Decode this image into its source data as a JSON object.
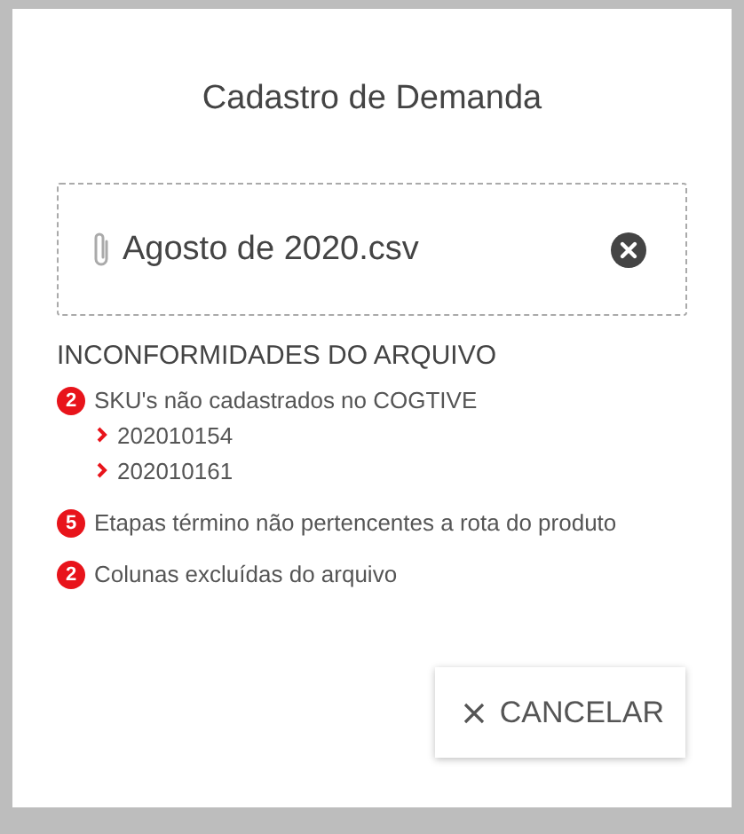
{
  "dialog": {
    "title": "Cadastro de Demanda"
  },
  "file": {
    "name": "Agosto de 2020.csv"
  },
  "section": {
    "title": "INCONFORMIDADES DO ARQUIVO"
  },
  "issues": [
    {
      "count": "2",
      "text": "SKU's não cadastrados no COGTIVE",
      "children": [
        {
          "text": "202010154"
        },
        {
          "text": "202010161"
        }
      ]
    },
    {
      "count": "5",
      "text": "Etapas término não pertencentes a rota do produto"
    },
    {
      "count": "2",
      "text": "Colunas excluídas do arquivo"
    }
  ],
  "buttons": [
    {
      "label": "CANCELAR"
    }
  ]
}
